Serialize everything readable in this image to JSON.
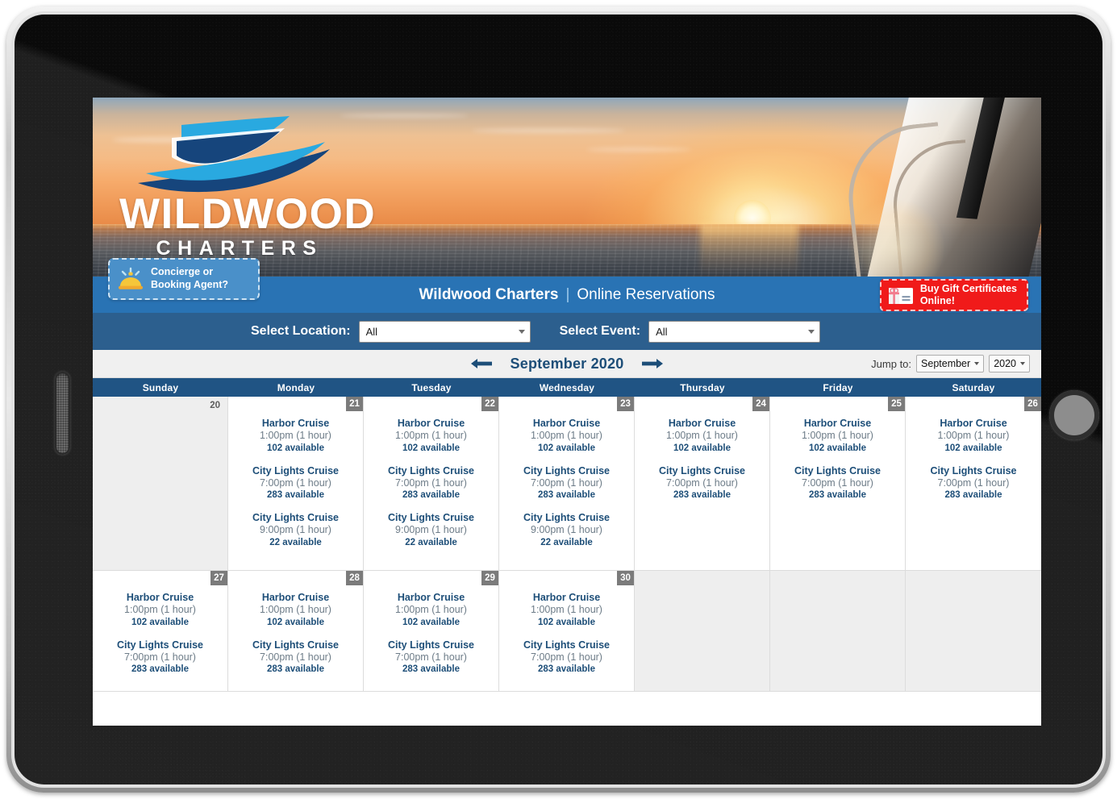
{
  "brand": {
    "logo_word": "WILDWOOD",
    "logo_sub": "CHARTERS",
    "logo_icon": "yacht-logo-icon"
  },
  "titlebar": {
    "brand": "Wildwood Charters",
    "divider": "|",
    "subtitle": "Online Reservations",
    "concierge": {
      "line1": "Concierge or",
      "line2": "Booking Agent?",
      "icon": "concierge-bell-icon"
    },
    "gift": {
      "line1": "Buy Gift Certificates",
      "line2": "Online!",
      "icon": "gift-card-icon"
    }
  },
  "filters": {
    "location_label": "Select Location:",
    "location_value": "All",
    "event_label": "Select Event:",
    "event_value": "All"
  },
  "monthbar": {
    "prev_icon": "arrow-left-icon",
    "next_icon": "arrow-right-icon",
    "month_label": "September 2020",
    "jump_label": "Jump to:",
    "jump_month": "September",
    "jump_year": "2020"
  },
  "calendar": {
    "weekdays": [
      "Sunday",
      "Monday",
      "Tuesday",
      "Wednesday",
      "Thursday",
      "Friday",
      "Saturday"
    ],
    "weeks": [
      [
        {
          "day": "20",
          "muted": true,
          "badge": false,
          "events": []
        },
        {
          "day": "21",
          "muted": false,
          "badge": true,
          "events": [
            {
              "name": "Harbor Cruise",
              "time": "1:00pm (1 hour)",
              "avail": "102 available"
            },
            {
              "name": "City Lights Cruise",
              "time": "7:00pm (1 hour)",
              "avail": "283 available"
            },
            {
              "name": "City Lights Cruise",
              "time": "9:00pm (1 hour)",
              "avail": "22 available"
            }
          ]
        },
        {
          "day": "22",
          "muted": false,
          "badge": true,
          "events": [
            {
              "name": "Harbor Cruise",
              "time": "1:00pm (1 hour)",
              "avail": "102 available"
            },
            {
              "name": "City Lights Cruise",
              "time": "7:00pm (1 hour)",
              "avail": "283 available"
            },
            {
              "name": "City Lights Cruise",
              "time": "9:00pm (1 hour)",
              "avail": "22 available"
            }
          ]
        },
        {
          "day": "23",
          "muted": false,
          "badge": true,
          "events": [
            {
              "name": "Harbor Cruise",
              "time": "1:00pm (1 hour)",
              "avail": "102 available"
            },
            {
              "name": "City Lights Cruise",
              "time": "7:00pm (1 hour)",
              "avail": "283 available"
            },
            {
              "name": "City Lights Cruise",
              "time": "9:00pm (1 hour)",
              "avail": "22 available"
            }
          ]
        },
        {
          "day": "24",
          "muted": false,
          "badge": true,
          "events": [
            {
              "name": "Harbor Cruise",
              "time": "1:00pm (1 hour)",
              "avail": "102 available"
            },
            {
              "name": "City Lights Cruise",
              "time": "7:00pm (1 hour)",
              "avail": "283 available"
            }
          ]
        },
        {
          "day": "25",
          "muted": false,
          "badge": true,
          "events": [
            {
              "name": "Harbor Cruise",
              "time": "1:00pm (1 hour)",
              "avail": "102 available"
            },
            {
              "name": "City Lights Cruise",
              "time": "7:00pm (1 hour)",
              "avail": "283 available"
            }
          ]
        },
        {
          "day": "26",
          "muted": false,
          "badge": true,
          "events": [
            {
              "name": "Harbor Cruise",
              "time": "1:00pm (1 hour)",
              "avail": "102 available"
            },
            {
              "name": "City Lights Cruise",
              "time": "7:00pm (1 hour)",
              "avail": "283 available"
            }
          ]
        }
      ],
      [
        {
          "day": "27",
          "muted": false,
          "badge": true,
          "events": [
            {
              "name": "Harbor Cruise",
              "time": "1:00pm (1 hour)",
              "avail": "102 available"
            },
            {
              "name": "City Lights Cruise",
              "time": "7:00pm (1 hour)",
              "avail": "283 available"
            }
          ]
        },
        {
          "day": "28",
          "muted": false,
          "badge": true,
          "events": [
            {
              "name": "Harbor Cruise",
              "time": "1:00pm (1 hour)",
              "avail": "102 available"
            },
            {
              "name": "City Lights Cruise",
              "time": "7:00pm (1 hour)",
              "avail": "283 available"
            }
          ]
        },
        {
          "day": "29",
          "muted": false,
          "badge": true,
          "events": [
            {
              "name": "Harbor Cruise",
              "time": "1:00pm (1 hour)",
              "avail": "102 available"
            },
            {
              "name": "City Lights Cruise",
              "time": "7:00pm (1 hour)",
              "avail": "283 available"
            }
          ]
        },
        {
          "day": "30",
          "muted": false,
          "badge": true,
          "events": [
            {
              "name": "Harbor Cruise",
              "time": "1:00pm (1 hour)",
              "avail": "102 available"
            },
            {
              "name": "City Lights Cruise",
              "time": "7:00pm (1 hour)",
              "avail": "283 available"
            }
          ]
        },
        {
          "day": "",
          "muted": true,
          "badge": false,
          "events": []
        },
        {
          "day": "",
          "muted": true,
          "badge": false,
          "events": []
        },
        {
          "day": "",
          "muted": true,
          "badge": false,
          "events": []
        }
      ]
    ]
  },
  "colors": {
    "title_blue": "#2973b4",
    "filter_blue": "#2c5f8e",
    "header_blue": "#205484",
    "text_blue": "#1d4e78",
    "gift_red": "#f01a1a",
    "badge_grey": "#7b7b7b"
  }
}
